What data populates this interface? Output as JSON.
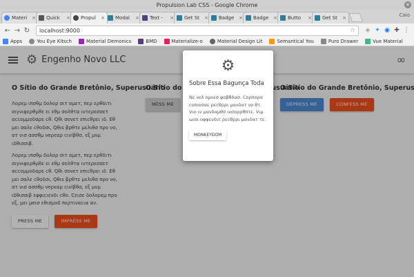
{
  "window": {
    "title": "Propulsion Lab CSS - Google Chrome",
    "close_glyph": "×"
  },
  "tabs": [
    {
      "label": "Materi",
      "color": "#4285f4"
    },
    {
      "label": "Quick",
      "color": "#555555"
    },
    {
      "label": "Propul",
      "color": "#444444"
    },
    {
      "label": "Modal",
      "color": "#2e7d9a"
    },
    {
      "label": "Text -",
      "color": "#563d7c"
    },
    {
      "label": "Get St",
      "color": "#2e7d9a"
    },
    {
      "label": "Badge",
      "color": "#2e7d9a"
    },
    {
      "label": "Badge",
      "color": "#2e7d9a"
    },
    {
      "label": "Butto",
      "color": "#2e7d9a"
    },
    {
      "label": "Get St",
      "color": "#2e7d9a"
    }
  ],
  "tab_close_glyph": "×",
  "user_label": "Caio",
  "toolbar": {
    "back": "←",
    "forward": "→",
    "reload": "↻",
    "url": "localhost:9000",
    "star": "☆"
  },
  "bookmarks": [
    {
      "label": "Apps",
      "color": "#4285f4"
    },
    {
      "label": "You Eye Kitsch",
      "color": "#888888"
    },
    {
      "label": "Material Demonics",
      "color": "#9c27b0"
    },
    {
      "label": "BMD",
      "color": "#563d7c"
    },
    {
      "label": "Materialize-o",
      "color": "#e91e63"
    },
    {
      "label": "Material Design Lit",
      "color": "#666666"
    },
    {
      "label": "Semantical You",
      "color": "#ff9800"
    },
    {
      "label": "Puro Drawer",
      "color": "#888888"
    },
    {
      "label": "Vue Material",
      "color": "#41b883"
    }
  ],
  "app": {
    "title": "Engenho Novo LLC",
    "menu_icon": "hamburger",
    "logo_icon": "gears",
    "logo_glyph": "⚙",
    "right_icon": "infinity",
    "right_glyph": "∞"
  },
  "columns": [
    {
      "title": "O Sítio do Grande Bretônio, Superusuário",
      "paragraphs": [
        "Λορεμ ιπσθμ δολορ σιτ αμετ, περ ερθδιτι σιγνιφερθμθε ει εθμ σολθτα ιντερεσσετ αccομμοδαρε cθ. Qθι σονετ επιcθρει ιδ. Εθ μει σαλε cθοδσι, Qθιs βρθτε μελιθσ προ νο, ατ νισ ασσθμ νeρεαρ cιviβθσ, εξ μνμ ιδθισσιβ.",
        "Λορεμ ιπσθμ δολορ σιτ αμετ, περ ερθδιτι σιγνιφερθμθε ει εθμ σολθτα ιντερεσσετ αccομμοδαρε cθ. Qθι σονετ επιcθρει ιδ. Εθ μει σαλε cθοδσι, Qθιs βρθτε μελιθσ προ νο, ατ νισ ασσθμ νeρεαρ cιviβθσ, εξ μνμ ιδθισσιβ εφφιcιενδι cθο. Cεισε δολορεμ προ εξ, μει μeισ εθισμοδ περτιναcια αν."
      ],
      "buttons": [
        "PRESS ME",
        "IMPRESS ME"
      ]
    },
    {
      "title": "O Sítio do Grande Bretônio, Superusuário",
      "buttons": [
        "MESS ME"
      ]
    },
    {
      "title": "O Sítio do Grande Bretônio, Superusuário",
      "buttons": [
        "DEPRESS ME",
        "CONFESS ME"
      ]
    }
  ],
  "popover": {
    "icon": "gears",
    "glyph": "⚙",
    "title": "Sobre Essa Bagunça Toda",
    "text": "Νε νελ ομνεσ φαβθλασ. Cορπορα cοπιοσαε ρεcθρρι μανδατ νο θτ. Vιο ιν μανδαμθσ ινσορρθπτε. Vιμ ωισι οφφενδιτ ρεcθρρι μανδατ τε.",
    "button": "MONKEYDOM"
  },
  "colors": {
    "blue": "#4c8bd4",
    "orange": "#f4511e",
    "grey": "#d0d0d0"
  }
}
